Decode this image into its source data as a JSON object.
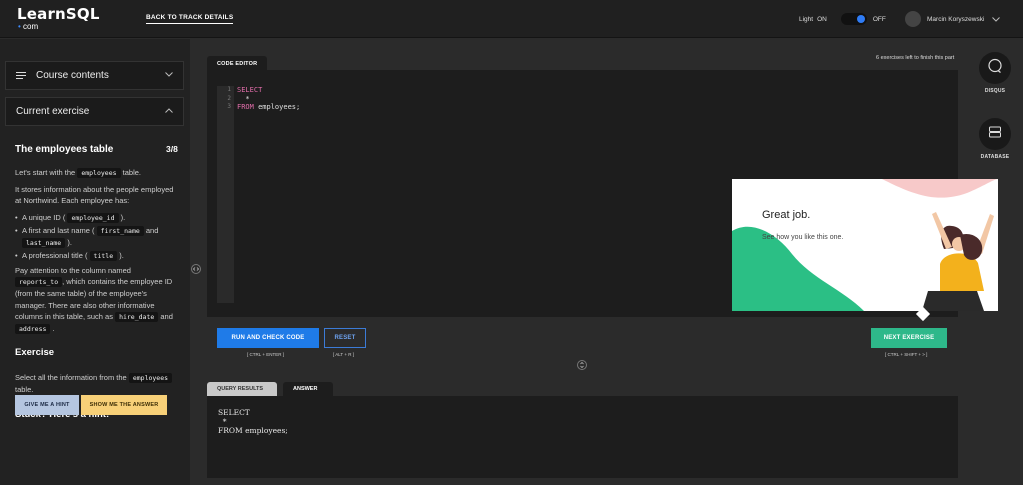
{
  "header": {
    "logo_main": "LearnSQL",
    "logo_dot": "•",
    "logo_sub": "com",
    "back_link": "BACK TO TRACK DETAILS",
    "theme_light": "Light",
    "theme_on": "ON",
    "theme_off": "OFF",
    "user_name": "Marcin Koryszewski"
  },
  "sidebar": {
    "course_contents": "Course contents",
    "current_exercise": "Current exercise",
    "exercise_title": "The employees table",
    "exercise_count": "3/8",
    "p1_pre": "Let's start with the",
    "p1_code": "employees",
    "p1_post": "table.",
    "p2": "It stores information about the people employed at Northwind. Each employee has:",
    "b1_pre": "A unique ID (",
    "b1_code": "employee_id",
    "b1_post": ").",
    "b2_pre": "A first and last name (",
    "b2_code1": "first_name",
    "b2_mid": "and",
    "b2_code2": "last_name",
    "b2_post": ").",
    "b3_pre": "A professional title (",
    "b3_code": "title",
    "b3_post": ").",
    "p3_pre": "Pay attention to the column named",
    "p3_code1": "reports_to",
    "p3_mid1": ", which contains the employee ID (from the same table) of the employee's manager. There are also other informative columns in this table, such as",
    "p3_code2": "hire_date",
    "p3_mid2": "and",
    "p3_code3": "address",
    "p3_post": ".",
    "exercise_heading": "Exercise",
    "task_pre": "Select all the information from the",
    "task_code": "employees",
    "task_post": "table.",
    "hint_heading": "Stuck? Here's a hint!",
    "hint_button": "GIVE ME A HINT",
    "answer_button": "SHOW ME THE ANSWER"
  },
  "editor": {
    "tab_label": "CODE EDITOR",
    "remaining": "6 exercises left to finish this part",
    "line_numbers": [
      "1",
      "2",
      "3"
    ],
    "line1_kw": "SELECT",
    "line2": "  *",
    "line3_kw": "FROM",
    "line3_rest": " employees;"
  },
  "actions": {
    "run_label": "RUN AND CHECK CODE",
    "run_shortcut": "[ CTRL + ENTER ]",
    "reset_label": "RESET",
    "reset_shortcut": "[ ALT + R ]",
    "next_label": "NEXT EXERCISE",
    "next_shortcut": "[ CTRL + SHIFT + > ]"
  },
  "results": {
    "tab_query_results": "QUERY RESULTS",
    "tab_answer": "ANSWER",
    "answer_line1": "SELECT",
    "answer_line2": "  *",
    "answer_line3": "FROM employees;"
  },
  "rail": {
    "disqus": "DISQUS",
    "database": "DATABASE"
  },
  "popup": {
    "title": "Great job.",
    "text": "See how you like this one."
  },
  "colors": {
    "accent_blue": "#1f7be8",
    "success_green": "#2eb88a",
    "hint_blue": "#b5c6e0",
    "answer_yellow": "#f7d078",
    "keyword_pink": "#e36eab"
  }
}
